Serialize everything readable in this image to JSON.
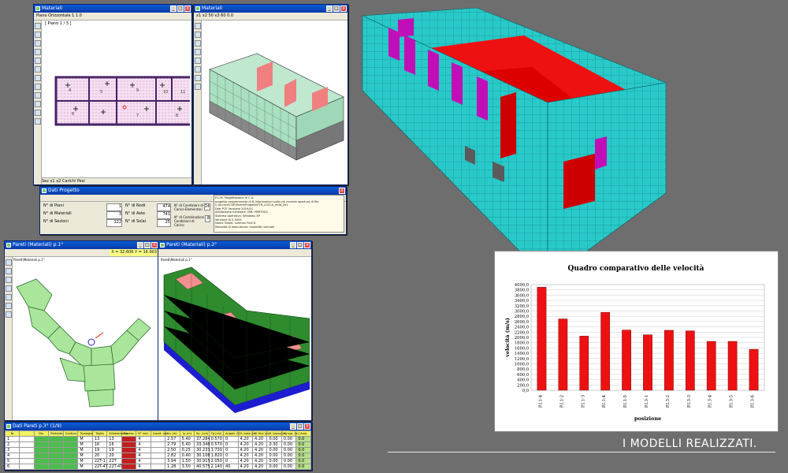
{
  "win_top_left": {
    "title": "Materiali",
    "toolbar": "Piano Orizzontale  1  1.0",
    "plan_label": "[ Piano 1 / 3 ]",
    "room_numbers": [
      "4",
      "5",
      "9",
      "10",
      "11",
      "6",
      "7",
      "8"
    ],
    "status": "Sez  x1  x2  Carichi  Pesi"
  },
  "win_top_right": {
    "title": "Materiali",
    "toolbar": "x1  x2  50  x3  60  0.0"
  },
  "win_props": {
    "title": "Dati Progetto",
    "left_labels": [
      "N° di Piani",
      "N° di Materiali",
      "N° di Sezioni"
    ],
    "left_values": [
      "1",
      "3",
      "122"
    ],
    "mid_labels": [
      "N° di Nodi",
      "N° di Aste",
      "N° di Solai"
    ],
    "mid_values": [
      "474",
      "741",
      "25"
    ],
    "right_labels": [
      "N° di Condizioni di Carico Elementari",
      "N° di Combinazioni Condizioni di Carico"
    ],
    "right_values": [
      "14",
      "8"
    ],
    "info_lines": [
      "P.C.M. Progettazione di C.A.",
      "progetto programmato di N informazioni sulla più recente apertura di file",
      "C:\\Archivi\\CSE\\Pareti\\Progetti\\PTR_LOCCA_mdb_2x1",
      "Dati PCE Versione 2019/01",
      "Abilitazione hardware USB: HRRT9Q2",
      "Sistema operativo: Windows XP",
      "Versione di S.3005",
      "Nome Totale: Lorenzo Fridi D",
      "Modalità di esecuzione: modalità normale"
    ]
  },
  "win_bottom_left": {
    "title": "Pareti (Materiali) p.1°",
    "coord": "X = 32.606  Y = 16.903",
    "sublabel": "Pareti\\Materiali p.1°"
  },
  "win_bottom_right": {
    "title": "Pareti (Materiali) p.2°",
    "sublabel": "Pareti\\Materiali p.1°"
  },
  "win_table": {
    "title": "Dati Pareti p.3° (1/9)",
    "headers": [
      "Nr",
      "",
      "Dis.",
      "Portante",
      "Controv.",
      "Tipologia",
      "Taglia",
      "Allineamento",
      "Fondaz.",
      "N° nod.",
      "Coord. nodi",
      "Lx (m)",
      "Ly (m)",
      "Sp. (cm)",
      "Tg (cm)",
      "Angolo (°)",
      "H. base (m)",
      "H. fine (m)",
      "H. basso (m)",
      "H. sup. (m)",
      "Area"
    ],
    "rows": [
      [
        "1",
        "",
        "",
        "",
        "",
        "M",
        "13",
        "13",
        "",
        "4",
        "",
        "2.57",
        "5.40",
        "37.284",
        "0.570",
        "0",
        "4.20",
        "4.20",
        "0.00",
        "0.00",
        "0.0"
      ],
      [
        "2",
        "",
        "",
        "",
        "",
        "M",
        "16",
        "16",
        "",
        "4",
        "",
        "2.79",
        "5.40",
        "33.348",
        "0.570",
        "0",
        "4.20",
        "4.20",
        "0.30",
        "0.00",
        "0.0"
      ],
      [
        "3",
        "",
        "",
        "",
        "",
        "M",
        "19",
        "19",
        "",
        "4",
        "",
        "2.50",
        "0.25",
        "30.233",
        "1.730",
        "0",
        "4.20",
        "4.20",
        "0.00",
        "0.00",
        "0.0"
      ],
      [
        "4",
        "",
        "",
        "",
        "",
        "M",
        "20",
        "20",
        "",
        "4",
        "",
        "2.82",
        "0.40",
        "30.108",
        "1.820",
        "0",
        "4.20",
        "4.20",
        "0.00",
        "0.00",
        "0.0"
      ],
      [
        "5",
        "",
        "",
        "",
        "",
        "M",
        "22T-1",
        "22T",
        "",
        "4",
        "",
        "3.94",
        "1.50",
        "30.915",
        "2.050",
        "0",
        "4.20",
        "4.20",
        "0.00",
        "0.00",
        "0.0"
      ],
      [
        "6",
        "",
        "",
        "",
        "",
        "M",
        "22T-4T",
        "22T-4T",
        "",
        "4",
        "",
        "1.28",
        "3.50",
        "40.575",
        "2.140",
        "40",
        "4.20",
        "4.20",
        "0.00",
        "0.00",
        "0.0"
      ]
    ]
  },
  "chart_data": {
    "type": "bar",
    "title": "Quadro comparativo delle velocità",
    "xlabel": "posizione",
    "ylabel": "velocità (m/s)",
    "categories": [
      "P.I.1-4",
      "P.I.1-2",
      "P.I.1-3",
      "P.I.1-4",
      "P.I.1-5",
      "P.I.3-1",
      "P.I.3-2",
      "P.I.3-3",
      "P.I.3-4",
      "P.I.3-5",
      "P.I.3-6"
    ],
    "values": [
      3900,
      2700,
      2050,
      2950,
      2280,
      2100,
      2270,
      2250,
      1850,
      1850,
      1550
    ],
    "ylim": [
      0,
      4000
    ],
    "yticks": [
      "0,0",
      "200,0",
      "400,0",
      "600,0",
      "800,0",
      "1000,0",
      "1200,0",
      "1400,0",
      "1600,0",
      "1800,0",
      "2000,0",
      "2200,0",
      "2400,0",
      "2600,0",
      "2800,0",
      "3000,0",
      "3200,0",
      "3400,0",
      "3600,0",
      "3800,0",
      "4000,0"
    ],
    "grid": true,
    "bar_color": "#ee1111"
  },
  "caption": "I MODELLI REALIZZATI."
}
